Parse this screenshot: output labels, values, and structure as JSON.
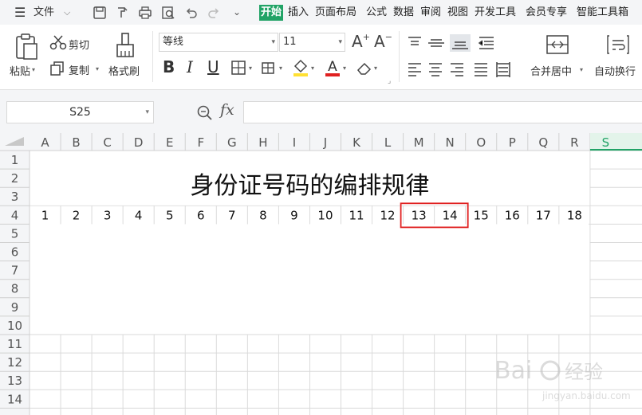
{
  "menu": {
    "file_label": "文件",
    "tabs": [
      {
        "label": "开始",
        "active": true
      },
      {
        "label": "插入",
        "active": false
      },
      {
        "label": "页面布局",
        "active": false
      },
      {
        "label": "公式",
        "active": false
      },
      {
        "label": "数据",
        "active": false
      },
      {
        "label": "审阅",
        "active": false
      },
      {
        "label": "视图",
        "active": false
      },
      {
        "label": "开发工具",
        "active": false
      },
      {
        "label": "会员专享",
        "active": false
      },
      {
        "label": "智能工具箱",
        "active": false
      }
    ],
    "icons": [
      "save-icon",
      "format-painter-icon",
      "print-icon",
      "print-preview-icon",
      "undo-icon",
      "redo-icon",
      "more-icon"
    ]
  },
  "ribbon": {
    "paste_label": "粘贴",
    "cut_label": "剪切",
    "copy_label": "复制",
    "format_painter_label": "格式刷",
    "font_name": "等线",
    "font_size": "11",
    "merge_label": "合并居中",
    "wrap_label": "自动换行",
    "font_color": "#e02020",
    "fill_color": "#ffe033"
  },
  "formula_bar": {
    "name_box": "S25",
    "fx_label": "fx",
    "formula_value": ""
  },
  "sheet": {
    "columns": [
      "A",
      "B",
      "C",
      "D",
      "E",
      "F",
      "G",
      "H",
      "I",
      "J",
      "K",
      "L",
      "M",
      "N",
      "O",
      "P",
      "Q",
      "R",
      "S"
    ],
    "selected_column": "S",
    "rows": [
      "1",
      "2",
      "3",
      "4",
      "5",
      "6",
      "7",
      "8",
      "9",
      "10",
      "11",
      "12",
      "13",
      "14"
    ],
    "title": "身份证号码的编排规律",
    "row4_values": [
      "1",
      "2",
      "3",
      "4",
      "5",
      "6",
      "7",
      "8",
      "9",
      "10",
      "11",
      "12",
      "13",
      "14",
      "15",
      "16",
      "17",
      "18"
    ],
    "highlight_cells": [
      "13",
      "14"
    ],
    "highlight_color": "#e02020",
    "accent_color": "#21a366"
  },
  "watermark": {
    "brand": "Bai",
    "brand_suffix": "经验",
    "url": "jingyan.baidu.com"
  }
}
